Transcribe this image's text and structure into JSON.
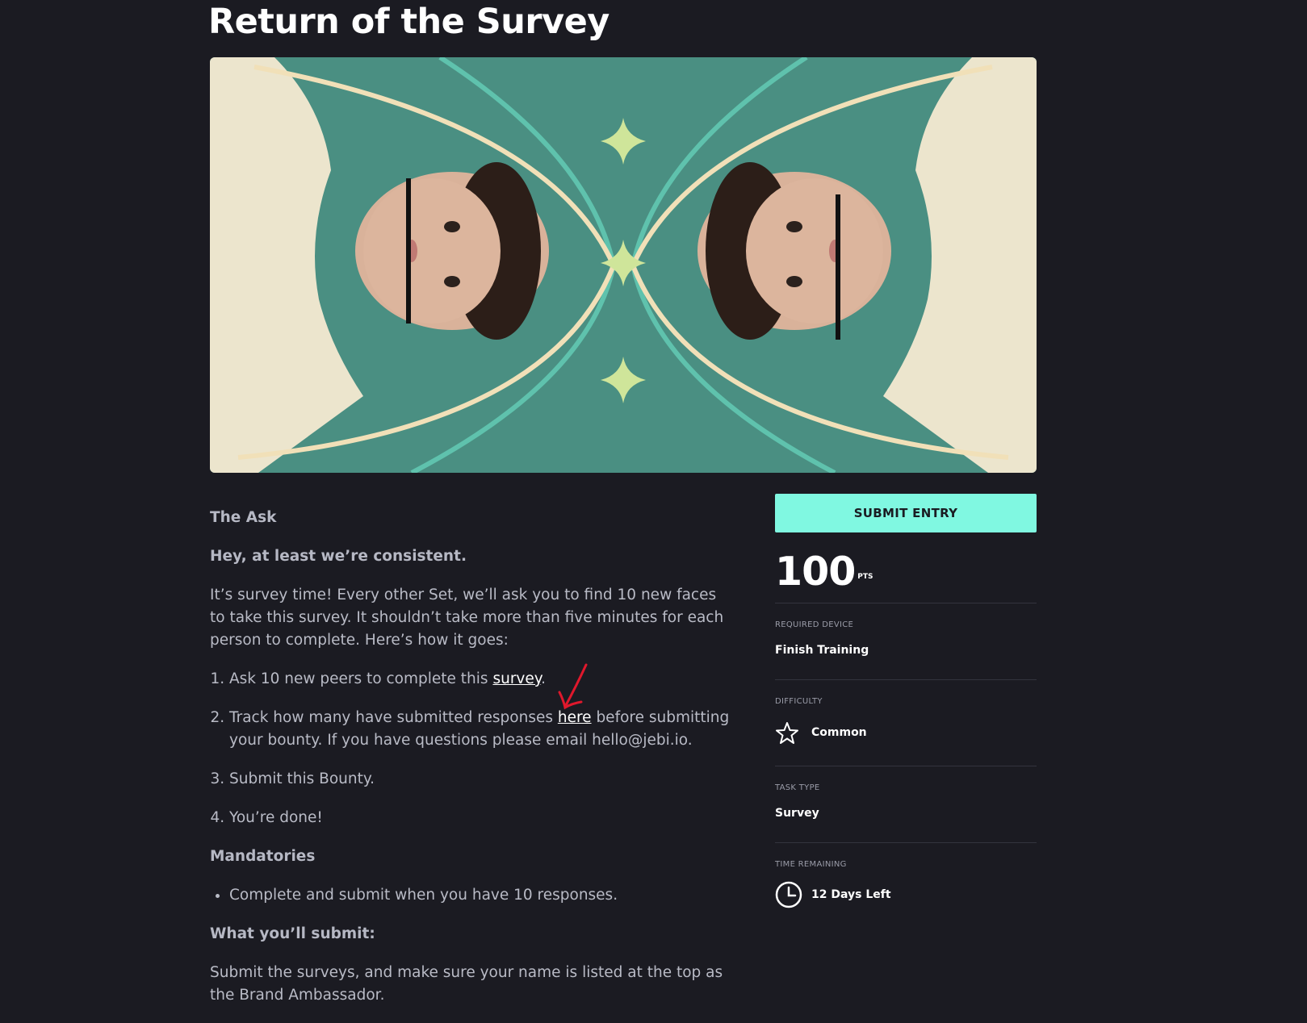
{
  "page": {
    "title": "Return of the Survey"
  },
  "hero": {
    "alt": "Mirrored portraits of a young man with curly hair holding a pen against his face, on a teal background with gold arcs and sparkle stars"
  },
  "ask": {
    "heading": "The Ask",
    "tagline": "Hey, at least we’re consistent.",
    "intro": "It’s survey time! Every other Set, we’ll ask you to find 10 new faces to take this survey. It shouldn’t take more than five minutes for each person to complete. Here’s how it goes:",
    "steps": [
      {
        "before": "Ask 10 new peers to complete this ",
        "link": "survey",
        "after": "."
      },
      {
        "before": "Track how many have submitted responses ",
        "link": "here",
        "after": " before submitting your bounty. If you have questions please email hello@jebi.io."
      },
      {
        "text": "Submit this Bounty."
      },
      {
        "text": "You’re done!"
      }
    ]
  },
  "mandatories": {
    "heading": "Mandatories",
    "items": [
      "Complete and submit when you have 10 responses."
    ]
  },
  "submission": {
    "heading": "What you’ll submit:",
    "text": "Submit the surveys, and make sure your name is listed at the top as the Brand Ambassador."
  },
  "sidebar": {
    "submit_label": "SUBMIT ENTRY",
    "points_value": "100",
    "points_unit": "PTS",
    "required_device_label": "REQUIRED DEVICE",
    "required_device_value": "Finish Training",
    "difficulty_label": "DIFFICULTY",
    "difficulty_value": "Common",
    "task_type_label": "TASK TYPE",
    "task_type_value": "Survey",
    "time_remaining_label": "TIME REMAINING",
    "time_remaining_value": "12 Days Left"
  },
  "colors": {
    "accent": "#80f8e1",
    "background": "#1b1b22",
    "hero_teal": "#4a8f82",
    "annotation_red": "#e0182c"
  },
  "icons": {
    "difficulty": "star-outline-icon",
    "time": "clock-icon",
    "annotation": "hand-drawn-arrow"
  }
}
